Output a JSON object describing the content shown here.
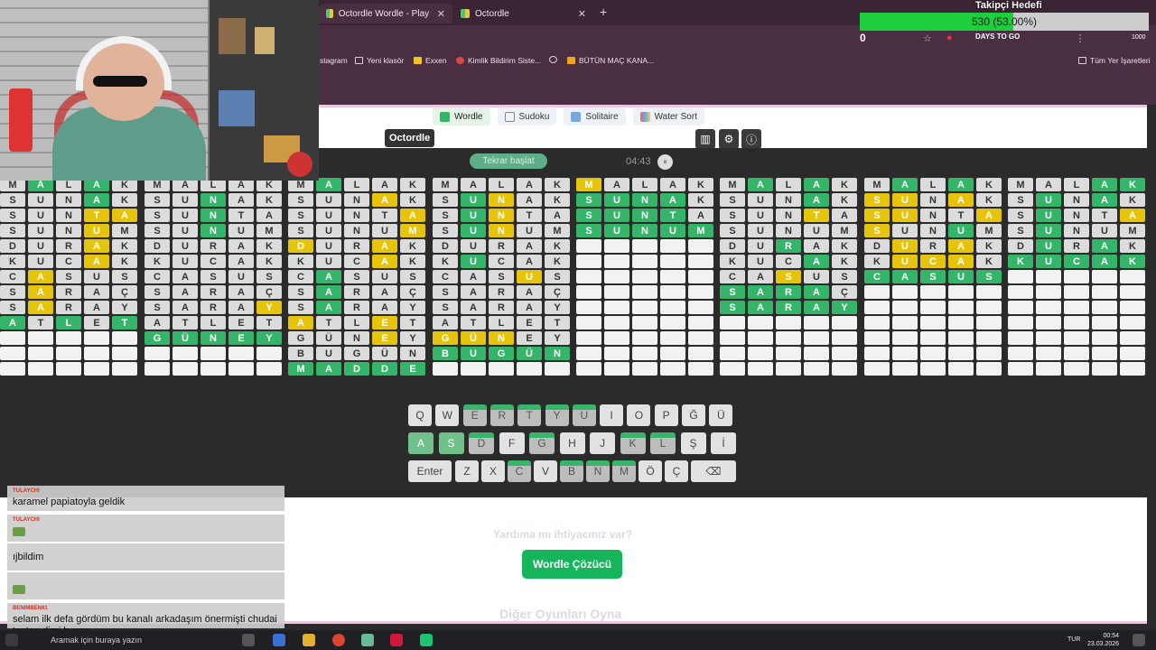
{
  "browser": {
    "tabs": [
      {
        "title": "Octordle Wordle - Play Octord",
        "active": true
      },
      {
        "title": "Octordle",
        "active": false
      }
    ],
    "bookmarks": [
      "stagram",
      "Yeni klasör",
      "Exxen",
      "Kimlik Bildirim Siste...",
      "",
      "BÜTÜN MAÇ KANA..."
    ],
    "all_bookmarks": "Tüm Yer İşaretleri"
  },
  "site": {
    "game_tabs": [
      "Wordle",
      "Sudoku",
      "Solitaire",
      "Water Sort"
    ],
    "badge": "Octordle",
    "restart": "Tekrar başlat",
    "timer": "04:43",
    "help_heading": "Yardıma mı ihtiyacınız var?",
    "solver_button": "Wordle Çözücü",
    "other_games": "Diğer Oyunları Oyna"
  },
  "boards": [
    {
      "rows": [
        [
          "M",
          "A",
          "L",
          "A",
          "K"
        ],
        [
          "S",
          "U",
          "N",
          "A",
          "K"
        ],
        [
          "S",
          "U",
          "N",
          "T",
          "A"
        ],
        [
          "S",
          "U",
          "N",
          "U",
          "M"
        ],
        [
          "D",
          "U",
          "R",
          "A",
          "K"
        ],
        [
          "K",
          "U",
          "C",
          "A",
          "K"
        ],
        [
          "C",
          "A",
          "S",
          "U",
          "S"
        ],
        [
          "S",
          "A",
          "R",
          "A",
          "Ç"
        ],
        [
          "S",
          "A",
          "R",
          "A",
          "Y"
        ],
        [
          "A",
          "T",
          "L",
          "E",
          "T"
        ],
        [
          "",
          "",
          "",
          "",
          ""
        ],
        [
          "",
          "",
          "",
          "",
          ""
        ],
        [
          "",
          "",
          "",
          "",
          ""
        ]
      ]
    },
    {
      "rows": [
        [
          "M",
          "A",
          "L",
          "A",
          "K"
        ],
        [
          "S",
          "U",
          "N",
          "A",
          "K"
        ],
        [
          "S",
          "U",
          "N",
          "T",
          "A"
        ],
        [
          "S",
          "U",
          "N",
          "U",
          "M"
        ],
        [
          "D",
          "U",
          "R",
          "A",
          "K"
        ],
        [
          "K",
          "U",
          "C",
          "A",
          "K"
        ],
        [
          "C",
          "A",
          "S",
          "U",
          "S"
        ],
        [
          "S",
          "A",
          "R",
          "A",
          "Ç"
        ],
        [
          "S",
          "A",
          "R",
          "A",
          "Y"
        ],
        [
          "A",
          "T",
          "L",
          "E",
          "T"
        ],
        [
          "G",
          "Ü",
          "N",
          "E",
          "Y"
        ],
        [
          "",
          "",
          "",
          "",
          ""
        ],
        [
          "",
          "",
          "",
          "",
          ""
        ]
      ]
    },
    {
      "rows": [
        [
          "M",
          "A",
          "L",
          "A",
          "K"
        ],
        [
          "S",
          "U",
          "N",
          "A",
          "K"
        ],
        [
          "S",
          "U",
          "N",
          "T",
          "A"
        ],
        [
          "S",
          "U",
          "N",
          "U",
          "M"
        ],
        [
          "D",
          "U",
          "R",
          "A",
          "K"
        ],
        [
          "K",
          "U",
          "C",
          "A",
          "K"
        ],
        [
          "C",
          "A",
          "S",
          "U",
          "S"
        ],
        [
          "S",
          "A",
          "R",
          "A",
          "Ç"
        ],
        [
          "S",
          "A",
          "R",
          "A",
          "Y"
        ],
        [
          "A",
          "T",
          "L",
          "E",
          "T"
        ],
        [
          "G",
          "Ü",
          "N",
          "E",
          "Y"
        ],
        [
          "B",
          "U",
          "G",
          "Ü",
          "N"
        ],
        [
          "M",
          "A",
          "D",
          "D",
          "E"
        ]
      ]
    },
    {
      "rows": [
        [
          "M",
          "A",
          "L",
          "A",
          "K"
        ],
        [
          "S",
          "U",
          "N",
          "A",
          "K"
        ],
        [
          "S",
          "U",
          "N",
          "T",
          "A"
        ],
        [
          "S",
          "U",
          "N",
          "U",
          "M"
        ],
        [
          "D",
          "U",
          "R",
          "A",
          "K"
        ],
        [
          "K",
          "U",
          "C",
          "A",
          "K"
        ],
        [
          "C",
          "A",
          "S",
          "U",
          "S"
        ],
        [
          "S",
          "A",
          "R",
          "A",
          "Ç"
        ],
        [
          "S",
          "A",
          "R",
          "A",
          "Y"
        ],
        [
          "A",
          "T",
          "L",
          "E",
          "T"
        ],
        [
          "G",
          "Ü",
          "N",
          "E",
          "Y"
        ],
        [
          "B",
          "U",
          "G",
          "Ü",
          "N"
        ],
        [
          "",
          "",
          "",
          "",
          ""
        ]
      ]
    },
    {
      "rows": [
        [
          "M",
          "A",
          "L",
          "A",
          "K"
        ],
        [
          "S",
          "U",
          "N",
          "A",
          "K"
        ],
        [
          "S",
          "U",
          "N",
          "T",
          "A"
        ],
        [
          "S",
          "U",
          "N",
          "U",
          "M"
        ],
        [
          "",
          "",
          "",
          "",
          ""
        ],
        [
          "",
          "",
          "",
          "",
          ""
        ],
        [
          "",
          "",
          "",
          "",
          ""
        ],
        [
          "",
          "",
          "",
          "",
          ""
        ],
        [
          "",
          "",
          "",
          "",
          ""
        ],
        [
          "",
          "",
          "",
          "",
          ""
        ],
        [
          "",
          "",
          "",
          "",
          ""
        ],
        [
          "",
          "",
          "",
          "",
          ""
        ],
        [
          "",
          "",
          "",
          "",
          ""
        ]
      ]
    },
    {
      "rows": [
        [
          "M",
          "A",
          "L",
          "A",
          "K"
        ],
        [
          "S",
          "U",
          "N",
          "A",
          "K"
        ],
        [
          "S",
          "U",
          "N",
          "T",
          "A"
        ],
        [
          "S",
          "U",
          "N",
          "U",
          "M"
        ],
        [
          "D",
          "U",
          "R",
          "A",
          "K"
        ],
        [
          "K",
          "U",
          "C",
          "A",
          "K"
        ],
        [
          "C",
          "A",
          "S",
          "U",
          "S"
        ],
        [
          "S",
          "A",
          "R",
          "A",
          "Ç"
        ],
        [
          "S",
          "A",
          "R",
          "A",
          "Y"
        ],
        [
          "",
          "",
          "",
          "",
          ""
        ],
        [
          "",
          "",
          "",
          "",
          ""
        ],
        [
          "",
          "",
          "",
          "",
          ""
        ],
        [
          "",
          "",
          "",
          "",
          ""
        ]
      ]
    },
    {
      "rows": [
        [
          "M",
          "A",
          "L",
          "A",
          "K"
        ],
        [
          "S",
          "U",
          "N",
          "A",
          "K"
        ],
        [
          "S",
          "U",
          "N",
          "T",
          "A"
        ],
        [
          "S",
          "U",
          "N",
          "U",
          "M"
        ],
        [
          "D",
          "U",
          "R",
          "A",
          "K"
        ],
        [
          "K",
          "U",
          "C",
          "A",
          "K"
        ],
        [
          "C",
          "A",
          "S",
          "U",
          "S"
        ],
        [
          "",
          "",
          "",
          "",
          ""
        ],
        [
          "",
          "",
          "",
          "",
          ""
        ],
        [
          "",
          "",
          "",
          "",
          ""
        ],
        [
          "",
          "",
          "",
          "",
          ""
        ],
        [
          "",
          "",
          "",
          "",
          ""
        ],
        [
          "",
          "",
          "",
          "",
          ""
        ]
      ]
    },
    {
      "rows": [
        [
          "M",
          "A",
          "L",
          "A",
          "K"
        ],
        [
          "S",
          "U",
          "N",
          "A",
          "K"
        ],
        [
          "S",
          "U",
          "N",
          "T",
          "A"
        ],
        [
          "S",
          "U",
          "N",
          "U",
          "M"
        ],
        [
          "D",
          "U",
          "R",
          "A",
          "K"
        ],
        [
          "K",
          "U",
          "C",
          "A",
          "K"
        ],
        [
          "",
          "",
          "",
          "",
          ""
        ],
        [
          "",
          "",
          "",
          "",
          ""
        ],
        [
          "",
          "",
          "",
          "",
          ""
        ],
        [
          "",
          "",
          "",
          "",
          ""
        ],
        [
          "",
          "",
          "",
          "",
          ""
        ],
        [
          "",
          "",
          "",
          "",
          ""
        ],
        [
          "",
          "",
          "",
          "",
          ""
        ]
      ]
    }
  ],
  "colors": {
    "b0": [
      "xgxgx",
      "xxxgx",
      "xxxyy",
      "xxxyx",
      "xxxyx",
      "xxxyx",
      "xyxxx",
      "xyxxx",
      "xyxxx",
      "gxgxg",
      "eeeee",
      "eeeee",
      "eeeee"
    ],
    "b1": [
      "xxxxx",
      "xxgxx",
      "xxgxx",
      "xxgxx",
      "xxxxx",
      "xxxxx",
      "xxxxx",
      "xxxxx",
      "xxxxy",
      "xxxxx",
      "ggggg",
      "eeeee",
      "eeeee"
    ],
    "b2": [
      "xgxxx",
      "xxxyx",
      "xxxxy",
      "xxxxy",
      "yxxyx",
      "xxxyx",
      "xgxxx",
      "xgxxx",
      "xgxxx",
      "yxxyx",
      "xxxyx",
      "xxxxx",
      "ggggg"
    ],
    "b3": [
      "xxxxx",
      "xgyxx",
      "xgyxx",
      "xgyxx",
      "xxxxx",
      "xgxxx",
      "xxxyx",
      "xxxxx",
      "xxxxx",
      "xxxxx",
      "yyyxx",
      "ggggg",
      "eeeee"
    ],
    "b4": [
      "yxxxx",
      "ggggx",
      "ggggx",
      "ggggg",
      "eeeee",
      "eeeee",
      "eeeee",
      "eeeee",
      "eeeee",
      "eeeee",
      "eeeee",
      "eeeee",
      "eeeee"
    ],
    "b5": [
      "xgxgx",
      "xxxgx",
      "xxxyx",
      "xxxxx",
      "xxgxx",
      "xxxgx",
      "xxyxx",
      "ggggx",
      "ggggg",
      "eeeee",
      "eeeee",
      "eeeee",
      "eeeee"
    ],
    "b6": [
      "xgxgx",
      "yyxyx",
      "yyxxy",
      "yxxgx",
      "xyxyx",
      "xyyyx",
      "ggggg",
      "eeeee",
      "eeeee",
      "eeeee",
      "eeeee",
      "eeeee",
      "eeeee"
    ],
    "b7": [
      "xxxgg",
      "xgxgx",
      "xgxxy",
      "xgxxx",
      "xgxgx",
      "ggggg",
      "eeeee",
      "eeeee",
      "eeeee",
      "eeeee",
      "eeeee",
      "eeeee",
      "eeeee"
    ]
  },
  "keyboard": {
    "row1": [
      "Q",
      "W",
      "E",
      "R",
      "T",
      "Y",
      "U",
      "I",
      "O",
      "P",
      "Ğ",
      "Ü"
    ],
    "row2": [
      "A",
      "S",
      "D",
      "F",
      "G",
      "H",
      "J",
      "K",
      "L",
      "Ş",
      "İ"
    ],
    "row3": [
      "Enter",
      "Z",
      "X",
      "C",
      "V",
      "B",
      "N",
      "M",
      "Ö",
      "Ç",
      "⌫"
    ]
  },
  "overlay": {
    "goal_title": "Takipçi Hedefi",
    "goal_text": "530 (53.00%)",
    "goal_progress": 0.53,
    "goal_start": "0",
    "goal_end": "1000",
    "days_to_go": "DAYS TO GO"
  },
  "chat": [
    {
      "user": "TULAYCHI",
      "text": "karamel papiatoyla geldik",
      "user_color": "#c0392b"
    },
    {
      "user": "TULAYCHI",
      "text": "",
      "user_color": "#c0392b",
      "emote": true
    },
    {
      "user": "",
      "text": "ıjbildim",
      "user_color": "#3b6fd1"
    },
    {
      "user": "",
      "text": "",
      "user_color": "#3b6fd1",
      "emote": true
    },
    {
      "user": "BENIMBEN61",
      "text": "selam ilk defa gördüm bu kanalı arkadaşım önermişti chudai taştan dimi burası",
      "user_color": "#c0392b"
    }
  ],
  "taskbar": {
    "search": "Aramak için buraya yazın",
    "lang": "TUR",
    "time": "00:54",
    "date": "23.03.2026"
  }
}
